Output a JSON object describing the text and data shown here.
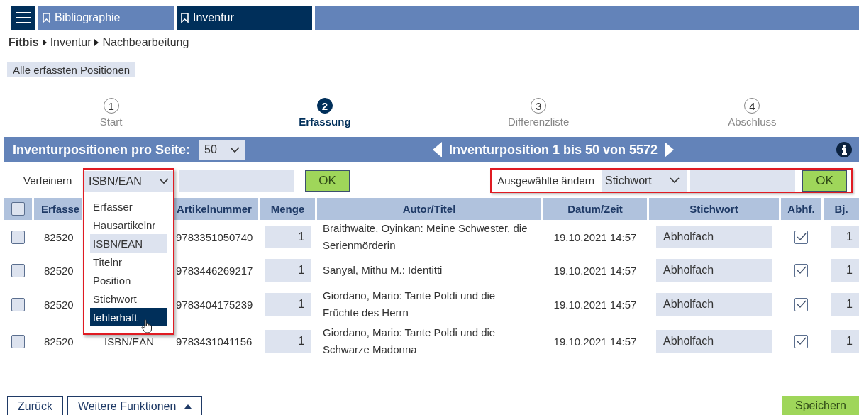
{
  "nav": {
    "tabs": [
      {
        "label": "Bibliographie",
        "selected": false
      },
      {
        "label": "Inventur",
        "selected": true
      }
    ]
  },
  "breadcrumb": [
    "Fitbis",
    "Inventur",
    "Nachbearbeitung"
  ],
  "filter_chip": "Alle erfassten Positionen",
  "steps": [
    {
      "number": "1",
      "label": "Start",
      "selected": false
    },
    {
      "number": "2",
      "label": "Erfassung",
      "selected": true
    },
    {
      "number": "3",
      "label": "Differenzliste",
      "selected": false
    },
    {
      "number": "4",
      "label": "Abschluss",
      "selected": false
    }
  ],
  "pager": {
    "label": "Inventurpositionen pro Seite:",
    "per_page": "50",
    "range": "Inventurposition 1 bis 50 von 5572"
  },
  "refine": {
    "label": "Verfeinern",
    "select": "ISBN/EAN",
    "ok": "OK",
    "options": [
      {
        "label": "Erfasser",
        "selected": false,
        "highlighted": false
      },
      {
        "label": "Hausartikelnr",
        "selected": false,
        "highlighted": false
      },
      {
        "label": "ISBN/EAN",
        "selected": true,
        "highlighted": false
      },
      {
        "label": "Titelnr",
        "selected": false,
        "highlighted": false
      },
      {
        "label": "Position",
        "selected": false,
        "highlighted": false
      },
      {
        "label": "Stichwort",
        "selected": false,
        "highlighted": false
      },
      {
        "label": "fehlerhaft",
        "selected": false,
        "highlighted": true
      }
    ]
  },
  "bulk": {
    "label": "Ausgewählte ändern",
    "select": "Stichwort",
    "ok": "OK"
  },
  "table": {
    "all_checked": false,
    "columns": [
      "Erfasse",
      "Artikelnummer",
      "Menge",
      "Autor/Titel",
      "Datum/Zeit",
      "Stichwort",
      "Abhf.",
      "Bj."
    ],
    "rows": [
      {
        "checked": false,
        "erfasser": "82520",
        "artikelnummer": "9783351050740",
        "menge": "1",
        "autor_titel": "Braithwaite, Oyinkan: Meine Schwester, die Serienmörderin",
        "datum_zeit": "19.10.2021 14:57",
        "stichwort": "Abholfach",
        "abhf": true,
        "bj": "1"
      },
      {
        "checked": false,
        "erfasser": "82520",
        "artikelnummer": "9783446269217",
        "menge": "1",
        "autor_titel": "Sanyal, Mithu M.: Identitti",
        "datum_zeit": "19.10.2021 14:57",
        "stichwort": "Abholfach",
        "abhf": true,
        "bj": "1"
      },
      {
        "checked": false,
        "erfasser": "82520",
        "artikelnummer": "9783404175239",
        "menge": "1",
        "autor_titel": "Giordano, Mario: Tante Poldi und die Früchte des Herrn",
        "datum_zeit": "19.10.2021 14:57",
        "stichwort": "Abholfach",
        "abhf": true,
        "bj": "1"
      },
      {
        "checked": false,
        "erfasser": "82520",
        "column_3": "ISBN/EAN",
        "artikelnummer": "9783431041156",
        "menge": "1",
        "autor_titel": "Giordano, Mario: Tante Poldi und die Schwarze Madonna",
        "datum_zeit": "19.10.2021 14:57",
        "stichwort": "Abholfach",
        "abhf": true,
        "bj": "1"
      }
    ]
  },
  "footer": {
    "buttons": [
      "Zurück",
      "Weitere Funktionen"
    ],
    "save": "Speichern"
  }
}
